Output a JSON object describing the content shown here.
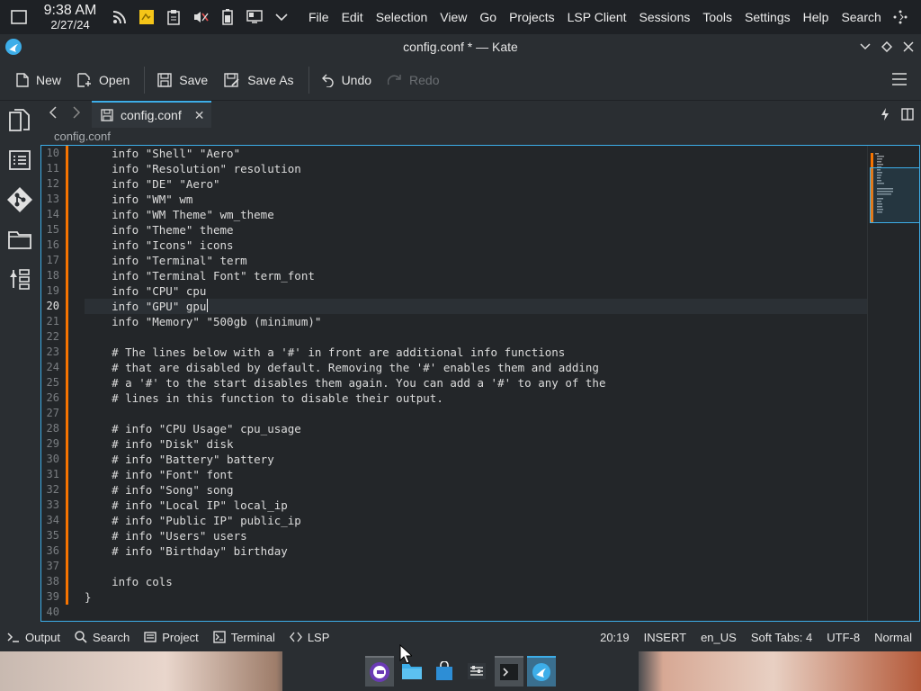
{
  "topbar": {
    "time": "9:38 AM",
    "date": "2/27/24",
    "menu": [
      "File",
      "Edit",
      "Selection",
      "View",
      "Go",
      "Projects",
      "LSP Client",
      "Sessions",
      "Tools",
      "Settings",
      "Help",
      "Search"
    ]
  },
  "window": {
    "title": "config.conf * — Kate"
  },
  "toolbar": {
    "new": "New",
    "open": "Open",
    "save": "Save",
    "save_as": "Save As",
    "undo": "Undo",
    "redo": "Redo"
  },
  "tabs": [
    {
      "label": "config.conf"
    }
  ],
  "breadcrumb": "config.conf",
  "editor": {
    "cursor_line": 20,
    "lines": [
      {
        "n": "10",
        "t": "    info \"Shell\" \"Aero\""
      },
      {
        "n": "11",
        "t": "    info \"Resolution\" resolution"
      },
      {
        "n": "12",
        "t": "    info \"DE\" \"Aero\""
      },
      {
        "n": "13",
        "t": "    info \"WM\" wm"
      },
      {
        "n": "14",
        "t": "    info \"WM Theme\" wm_theme"
      },
      {
        "n": "15",
        "t": "    info \"Theme\" theme"
      },
      {
        "n": "16",
        "t": "    info \"Icons\" icons"
      },
      {
        "n": "17",
        "t": "    info \"Terminal\" term"
      },
      {
        "n": "18",
        "t": "    info \"Terminal Font\" term_font"
      },
      {
        "n": "19",
        "t": "    info \"CPU\" cpu"
      },
      {
        "n": "20",
        "t": "    info \"GPU\" gpu"
      },
      {
        "n": "21",
        "t": "    info \"Memory\" \"500gb (minimum)\""
      },
      {
        "n": "22",
        "t": ""
      },
      {
        "n": "23",
        "t": "    # The lines below with a '#' in front are additional info functions"
      },
      {
        "n": "24",
        "t": "    # that are disabled by default. Removing the '#' enables them and adding"
      },
      {
        "n": "25",
        "t": "    # a '#' to the start disables them again. You can add a '#' to any of the"
      },
      {
        "n": "26",
        "t": "    # lines in this function to disable their output."
      },
      {
        "n": "27",
        "t": ""
      },
      {
        "n": "28",
        "t": "    # info \"CPU Usage\" cpu_usage"
      },
      {
        "n": "29",
        "t": "    # info \"Disk\" disk"
      },
      {
        "n": "30",
        "t": "    # info \"Battery\" battery"
      },
      {
        "n": "31",
        "t": "    # info \"Font\" font"
      },
      {
        "n": "32",
        "t": "    # info \"Song\" song"
      },
      {
        "n": "33",
        "t": "    # info \"Local IP\" local_ip"
      },
      {
        "n": "34",
        "t": "    # info \"Public IP\" public_ip"
      },
      {
        "n": "35",
        "t": "    # info \"Users\" users"
      },
      {
        "n": "36",
        "t": "    # info \"Birthday\" birthday"
      },
      {
        "n": "37",
        "t": ""
      },
      {
        "n": "38",
        "t": "    info cols"
      },
      {
        "n": "39",
        "t": "}"
      },
      {
        "n": "40",
        "t": ""
      }
    ]
  },
  "statusbar": {
    "tools": [
      "Output",
      "Search",
      "Project",
      "Terminal",
      "LSP"
    ],
    "position": "20:19",
    "mode": "INSERT",
    "language": "en_US",
    "indent": "Soft Tabs: 4",
    "encoding": "UTF-8",
    "highlight": "Normal"
  },
  "colors": {
    "accent": "#3daee9",
    "modified": "#f67400"
  }
}
